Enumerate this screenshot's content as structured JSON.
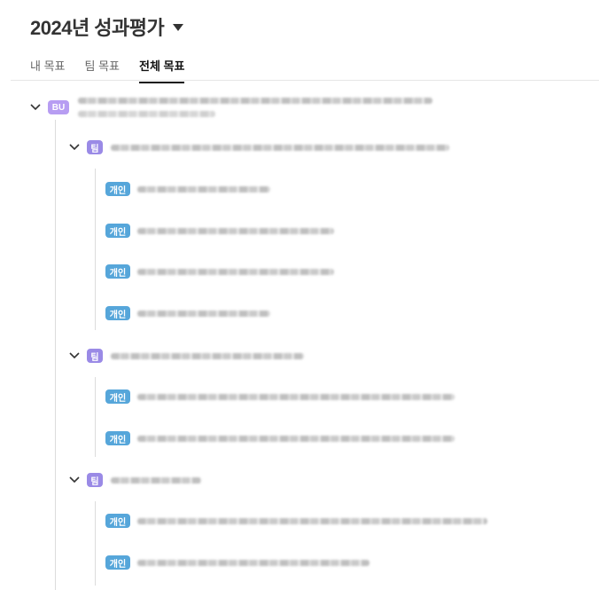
{
  "header": {
    "title": "2024년 성과평가"
  },
  "tabs": [
    {
      "label": "내 목표"
    },
    {
      "label": "팀 목표"
    },
    {
      "label": "전체 목표"
    }
  ],
  "badges": {
    "bu": "BU",
    "team": "팀",
    "person": "개인"
  }
}
